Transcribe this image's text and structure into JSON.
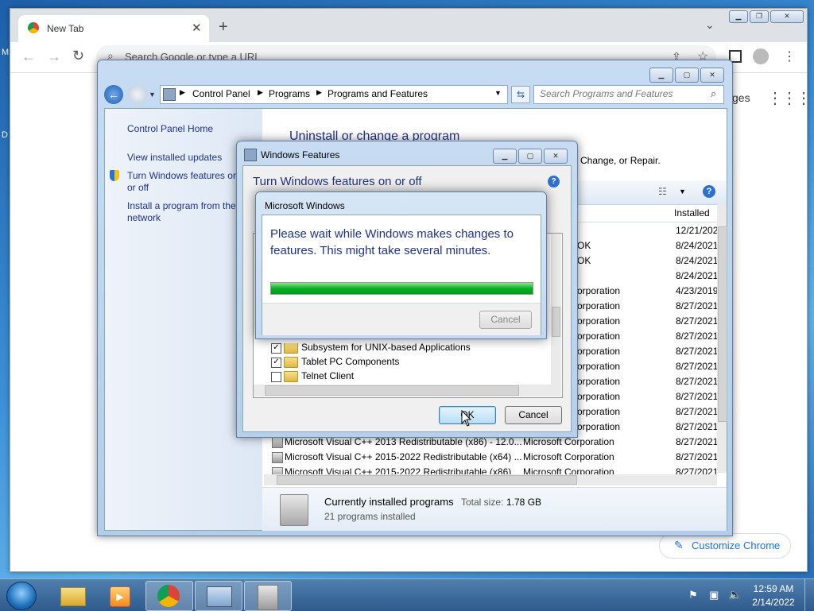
{
  "desktop": {
    "left_label": "M",
    "left_label2": "D"
  },
  "chrome": {
    "tab_title": "New Tab",
    "omnibox_placeholder": "Search Google or type a URL",
    "ntp_right_text": "ges",
    "customize_label": "Customize Chrome"
  },
  "control_panel": {
    "breadcrumb": [
      "Control Panel",
      "Programs",
      "Programs and Features"
    ],
    "search_placeholder": "Search Programs and Features",
    "left_links": {
      "home": "Control Panel Home",
      "updates": "View installed updates",
      "features": "Turn Windows features on or off",
      "network": "Install a program from the network"
    },
    "heading": "Uninstall or change a program",
    "subtext": "Change, or Repair.",
    "col_installed": "Installed",
    "rows": [
      {
        "name": "",
        "publisher": "",
        "date": "12/21/202"
      },
      {
        "name": "",
        "publisher": "OK",
        "date": "8/24/2021"
      },
      {
        "name": "",
        "publisher": "OK",
        "date": "8/24/2021"
      },
      {
        "name": "",
        "publisher": "",
        "date": "8/24/2021"
      },
      {
        "name": "",
        "publisher": "orporation",
        "date": "4/23/2019"
      },
      {
        "name": "",
        "publisher": "orporation",
        "date": "8/27/2021"
      },
      {
        "name": "",
        "publisher": "orporation",
        "date": "8/27/2021"
      },
      {
        "name": "",
        "publisher": "orporation",
        "date": "8/27/2021"
      },
      {
        "name": "",
        "publisher": "orporation",
        "date": "8/27/2021"
      },
      {
        "name": "",
        "publisher": "orporation",
        "date": "8/27/2021"
      },
      {
        "name": "",
        "publisher": "orporation",
        "date": "8/27/2021"
      },
      {
        "name": "",
        "publisher": "orporation",
        "date": "8/27/2021"
      },
      {
        "name": "",
        "publisher": "orporation",
        "date": "8/27/2021"
      },
      {
        "name": "",
        "publisher": "orporation",
        "date": "8/27/2021"
      },
      {
        "name": "Microsoft Visual C++ 2013 Redistributable (x86) - 12.0...",
        "publisher": "Microsoft Corporation",
        "date": "8/27/2021"
      },
      {
        "name": "Microsoft Visual C++ 2015-2022 Redistributable (x64) ...",
        "publisher": "Microsoft Corporation",
        "date": "8/27/2021"
      },
      {
        "name": "Microsoft Visual C++ 2015-2022 Redistributable (x86)",
        "publisher": "Microsoft Corporation",
        "date": "8/27/2021"
      }
    ],
    "footer_title": "Currently installed programs",
    "footer_size_label": "Total size:",
    "footer_size": "1.78 GB",
    "footer_count": "21 programs installed"
  },
  "windows_features": {
    "title": "Windows Features",
    "heading": "Turn Windows features on or off",
    "list_items": [
      {
        "label": "Subsystem for UNIX-based Applications",
        "checked": true
      },
      {
        "label": "Tablet PC Components",
        "checked": true
      },
      {
        "label": "Telnet Client",
        "checked": false
      }
    ],
    "ok_label": "OK",
    "cancel_label": "Cancel"
  },
  "progress_dialog": {
    "title": "Microsoft Windows",
    "message": "Please wait while Windows makes changes to features. This might take several minutes.",
    "progress_fraction": 1.0,
    "cancel_label": "Cancel"
  },
  "taskbar": {
    "time": "12:59 AM",
    "date": "2/14/2022"
  },
  "colors": {
    "progress_green": "#06b025",
    "link_blue": "#1e3287",
    "heading_blue": "#1e3287"
  }
}
